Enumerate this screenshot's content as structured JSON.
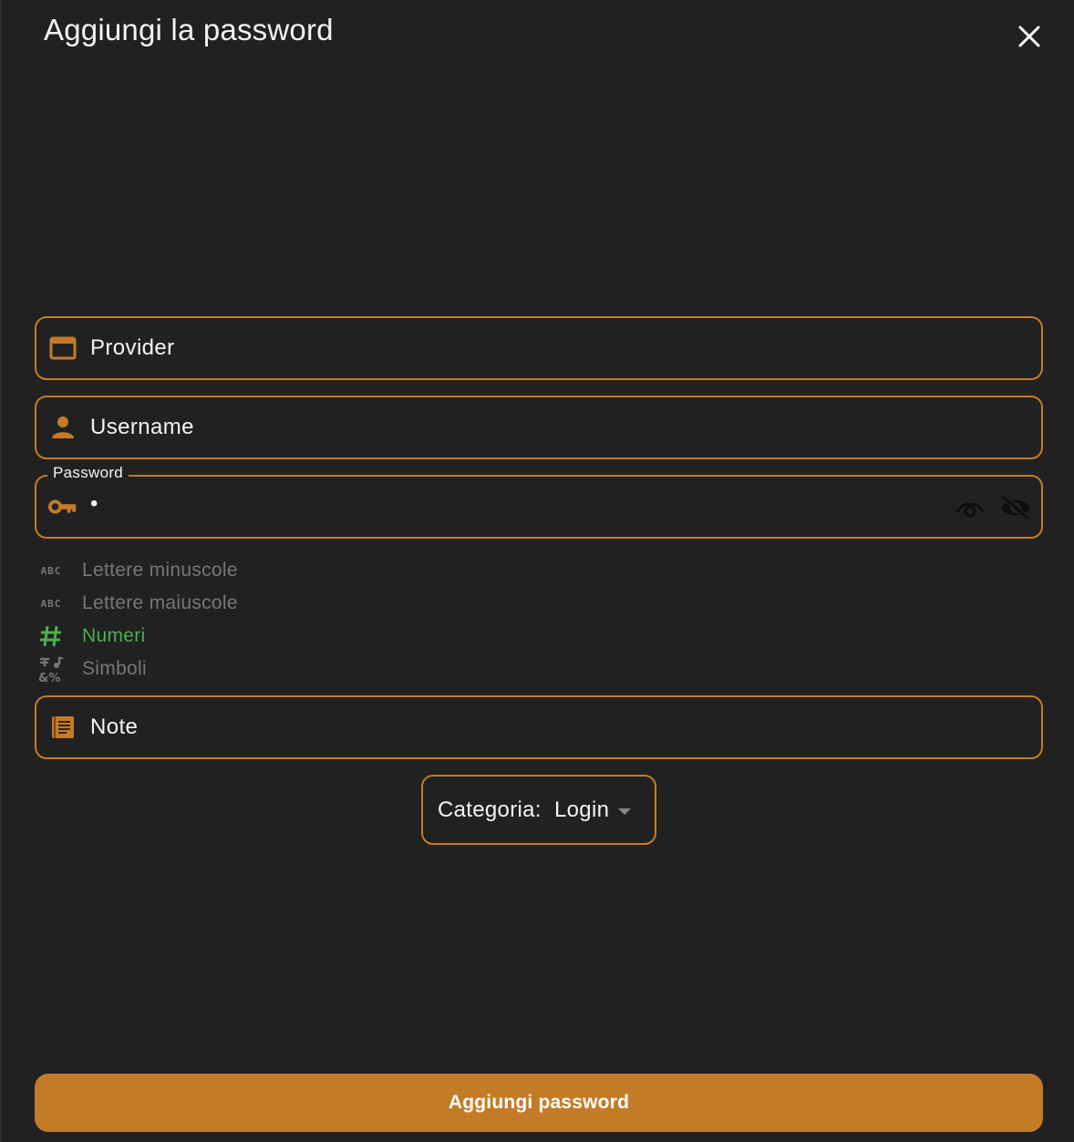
{
  "dialog": {
    "title": "Aggiungi la password",
    "close_icon": "close-icon"
  },
  "form": {
    "provider": {
      "label": "Provider",
      "icon": "browser-window-icon"
    },
    "username": {
      "label": "Username",
      "icon": "person-icon"
    },
    "password": {
      "label": "Password",
      "value": "•",
      "icon": "key-icon",
      "show_icon": "eye-icon",
      "hide_icon": "eye-off-icon"
    },
    "requirements": [
      {
        "label": "Lettere minuscole",
        "icon": "abc-icon",
        "icon_text": "ABC",
        "met": false
      },
      {
        "label": "Lettere maiuscole",
        "icon": "abc-icon",
        "icon_text": "ABC",
        "met": false
      },
      {
        "label": "Numeri",
        "icon": "hashtag-icon",
        "met": true
      },
      {
        "label": "Simboli",
        "icon": "symbols-icon",
        "met": false
      }
    ],
    "note": {
      "label": "Note",
      "icon": "notes-icon"
    },
    "category": {
      "label": "Categoria:",
      "value": "Login"
    },
    "submit_label": "Aggiungi password"
  },
  "colors": {
    "background": "#212121",
    "accent": "#c47b28",
    "text": "#f4f4f4",
    "muted": "#777777",
    "success": "#4caf50"
  }
}
